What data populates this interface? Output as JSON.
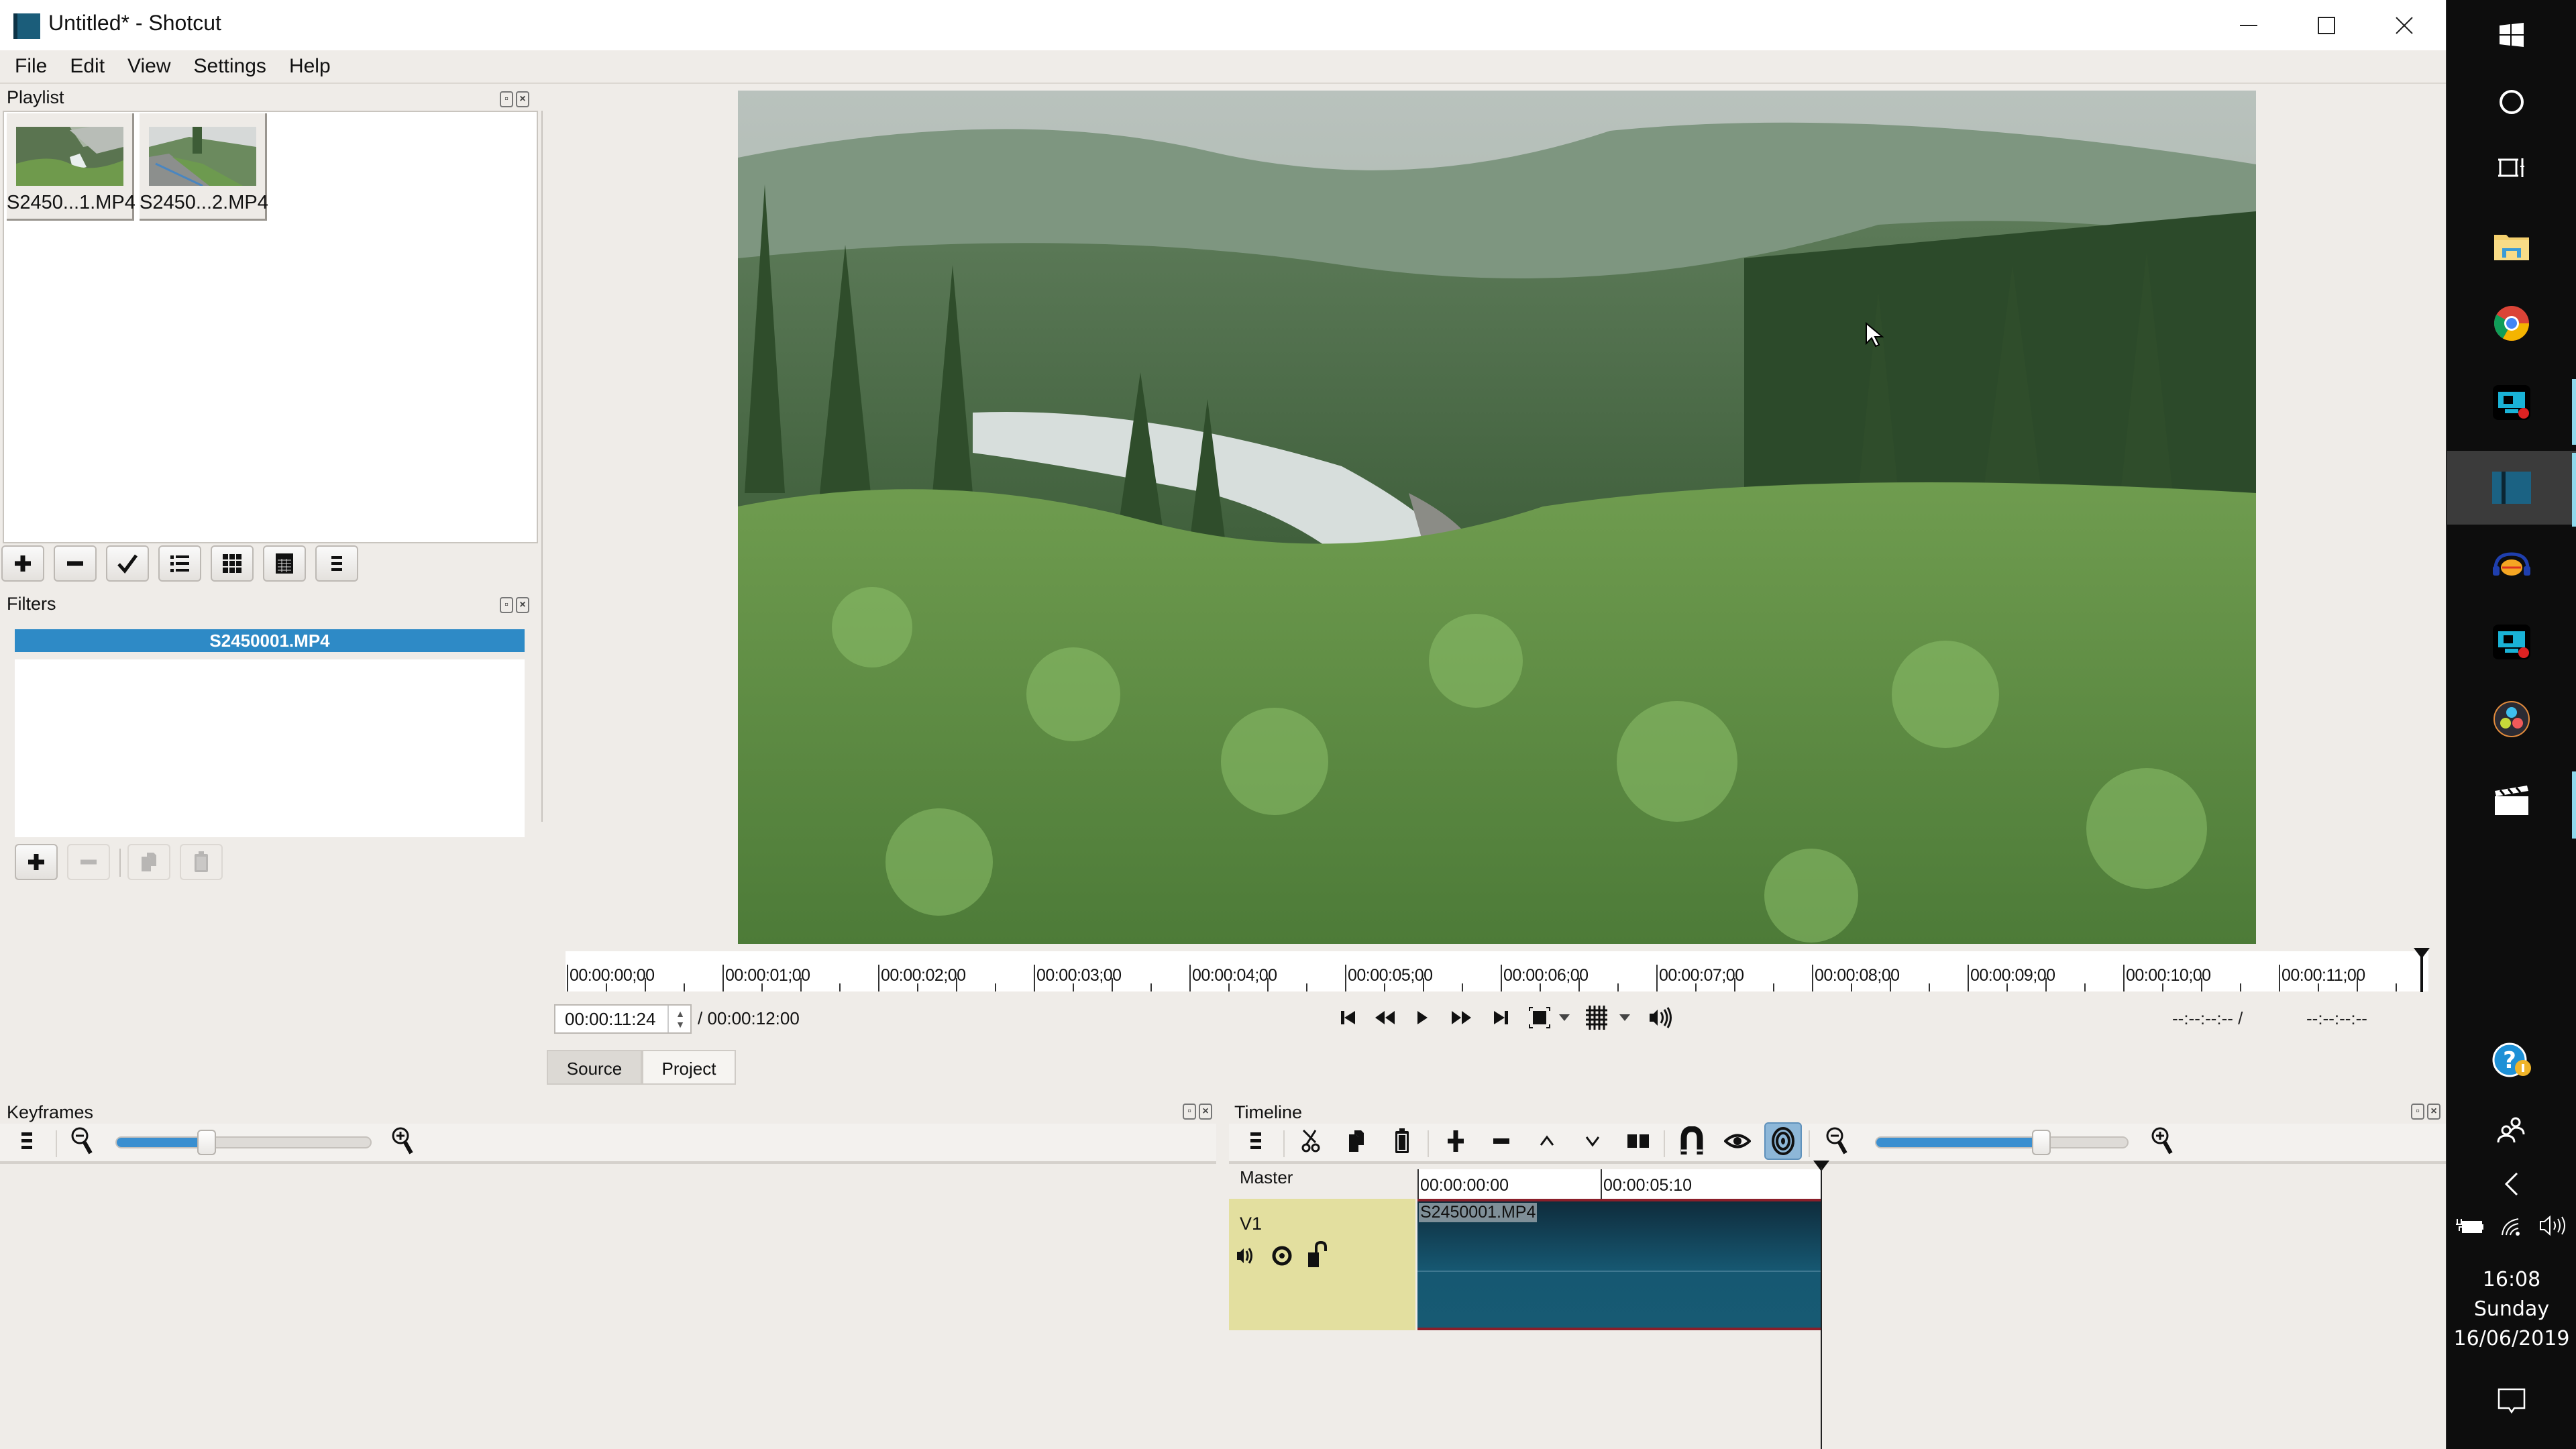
{
  "window": {
    "title": "Untitled* - Shotcut",
    "controls": {
      "minimize": "minimize-icon",
      "maximize": "maximize-icon",
      "close": "close-icon"
    }
  },
  "menu": [
    "File",
    "Edit",
    "View",
    "Settings",
    "Help"
  ],
  "playlist": {
    "title": "Playlist",
    "items": [
      {
        "label": "S2450...1.MP4",
        "thumb_colors": [
          "#5f7f52",
          "#9cb08a",
          "#6f9a4c"
        ]
      },
      {
        "label": "S2450...2.MP4",
        "thumb_colors": [
          "#bfc5c3",
          "#7f8a7a",
          "#6b9455"
        ]
      }
    ],
    "toolbar": [
      "add-icon",
      "remove-icon",
      "update-icon",
      "details-view-icon",
      "tiles-view-icon",
      "icons-view-icon",
      "menu-icon"
    ]
  },
  "filters": {
    "title": "Filters",
    "selected_clip": "S2450001.MP4",
    "toolbar": [
      {
        "icon": "add-icon",
        "enabled": true
      },
      {
        "icon": "remove-icon",
        "enabled": false
      },
      {
        "icon": "copy-icon",
        "enabled": false
      },
      {
        "icon": "paste-icon",
        "enabled": false
      }
    ]
  },
  "player": {
    "ruler_labels": [
      "00:00:00;00",
      "00:00:01;00",
      "00:00:02;00",
      "00:00:03;00",
      "00:00:04;00",
      "00:00:05;00",
      "00:00:06;00",
      "00:00:07;00",
      "00:00:08;00",
      "00:00:09;00",
      "00:00:10;00",
      "00:00:11;00"
    ],
    "current_time": "00:00:11:24",
    "total_time": "/ 00:00:12:00",
    "in_point": "--:--:--:-- /",
    "out_point": "--:--:--:--",
    "transport": [
      "skip-to-start-icon",
      "rewind-icon",
      "play-icon",
      "fast-forward-icon",
      "skip-to-end-icon",
      "zoom-fit-icon",
      "dropdown-icon",
      "grid-icon",
      "dropdown-icon",
      "volume-icon"
    ],
    "tabs": [
      "Source",
      "Project"
    ],
    "active_tab": "Source"
  },
  "keyframes": {
    "title": "Keyframes",
    "zoom_level": 0.35
  },
  "timeline": {
    "title": "Timeline",
    "toolbar": [
      "menu-icon",
      "cut-icon",
      "copy-icon",
      "paste-icon",
      "append-icon",
      "remove-icon",
      "lift-icon",
      "overwrite-icon",
      "split-icon",
      "snap-icon",
      "scrub-icon",
      "ripple-icon",
      "zoom-out-icon",
      "zoom-in-icon"
    ],
    "zoom_level": 0.65,
    "master_label": "Master",
    "ruler_labels": [
      "00:00:00:00",
      "00:00:05:10"
    ],
    "tracks": [
      {
        "name": "V1",
        "clips": [
          {
            "label": "S2450001.MP4"
          }
        ]
      }
    ]
  },
  "taskbar": {
    "apps": [
      "windows-start-icon",
      "cortana-icon",
      "task-view-icon",
      "file-explorer-icon",
      "chrome-icon",
      "screen-recorder-icon",
      "shotcut-icon",
      "audacity-icon",
      "screen-recorder-icon",
      "davinci-resolve-icon",
      "video-clapper-icon"
    ],
    "tray": [
      "help-icon",
      "people-icon",
      "show-hidden-icon",
      "battery-icon",
      "wifi-icon",
      "speaker-icon"
    ],
    "time": "16:08",
    "day": "Sunday",
    "date": "16/06/2019"
  },
  "colors": {
    "selection_blue": "#2e8ac6",
    "track_header": "#e3df9f",
    "clip_teal": "#165872",
    "clip_border_red": "#8b1f2a",
    "taskbar_bg": "#0d0d0d"
  }
}
